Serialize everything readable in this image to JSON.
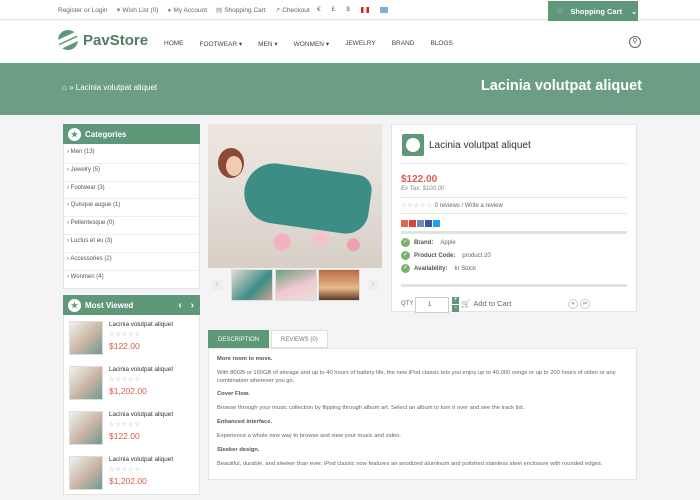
{
  "topbar": {
    "links": [
      {
        "label": "Register or Login",
        "icon": ""
      },
      {
        "label": "Wish List (0)",
        "icon": "heart-icon"
      },
      {
        "label": "My Account",
        "icon": "user-icon"
      },
      {
        "label": "Shopping Cart",
        "icon": "cart-icon"
      },
      {
        "label": "Checkout",
        "icon": "share-icon"
      }
    ],
    "currencies": [
      "€",
      "£",
      "$"
    ],
    "cart_label": "Shopping Cart"
  },
  "header": {
    "logo": "PavStore",
    "nav": [
      "HOME",
      "FOOTWEAR",
      "MEN",
      "WONMEN",
      "JEWELRY",
      "BRAND",
      "BLOGS"
    ]
  },
  "banner": {
    "breadcrumb": "Lacinia volutpat aliquet",
    "title": "Lacinia volutpat aliquet"
  },
  "categories": {
    "title": "Categories",
    "items": [
      "Men (13)",
      "Jewelry (5)",
      "Footwear (3)",
      "Quisque augue (1)",
      "Pellentesque (0)",
      "Luctus et eu (3)",
      "Accessories (2)",
      "Wonmen (4)"
    ]
  },
  "most_viewed": {
    "title": "Most Viewed",
    "items": [
      {
        "name": "Lacinia volutpat aliquet",
        "price": "$122.00"
      },
      {
        "name": "Lacinia volutpat aliquet",
        "price": "$1,202.00"
      },
      {
        "name": "Lacinia volutpat aliquet",
        "price": "$122.00"
      },
      {
        "name": "Lacinia volutpat aliquet",
        "price": "$1,202.00"
      }
    ]
  },
  "product": {
    "name": "Lacinia volutpat aliquet",
    "price": "$122.00",
    "ex_tax": "Ex Tax: $100.00",
    "reviews": "0 reviews / Write a review",
    "brand_label": "Brand:",
    "brand": "Apple",
    "code_label": "Product Code:",
    "code": "product 20",
    "avail_label": "Availability:",
    "avail": "In Stock",
    "qty_label": "QTY",
    "qty": "1",
    "add_to_cart": "Add to Cart"
  },
  "tabs": [
    "DESCRIPTION",
    "REVIEWS (0)"
  ],
  "description": [
    {
      "h": "More room to move.",
      "p": "With 80GB or 160GB of storage and up to 40 hours of battery life, the new iPod classic lets you enjoy up to 40,000 songs or up to 200 hours of video or any combination wherever you go."
    },
    {
      "h": "Cover Flow.",
      "p": "Browse through your music collection by flipping through album art. Select an album to turn it over and see the track list."
    },
    {
      "h": "Enhanced interface.",
      "p": "Experience a whole new way to browse and view your music and video."
    },
    {
      "h": "Sleeker design.",
      "p": "Beautiful, durable, and sleeker than ever, iPod classic now features an anodized aluminum and polished stainless steel enclosure with rounded edges."
    }
  ],
  "colors": {
    "accent": "#5f9779",
    "price": "#e05a4a",
    "banner": "#6c9e84"
  }
}
